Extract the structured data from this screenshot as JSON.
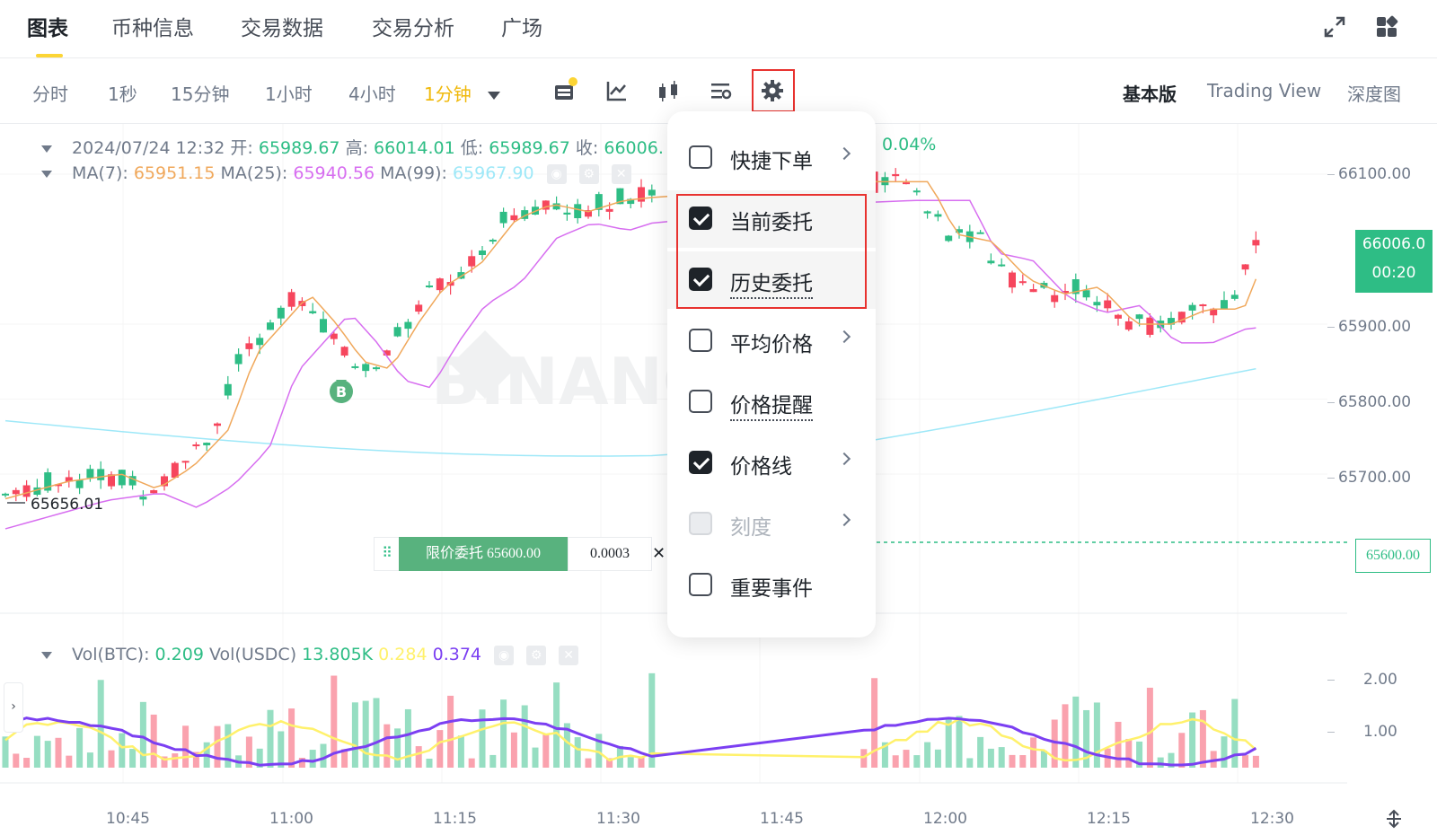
{
  "top_tabs": [
    "图表",
    "币种信息",
    "交易数据",
    "交易分析",
    "广场"
  ],
  "intervals": [
    "分时",
    "1秒",
    "15分钟",
    "1小时",
    "4小时"
  ],
  "active_interval": "1分钟",
  "view_options": [
    "基本版",
    "Trading View",
    "深度图"
  ],
  "legend": {
    "ohlc_prefix": "2024/07/24 12:32",
    "open_label": "开:",
    "open": "65989.67",
    "high_label": "高:",
    "high": "66014.01",
    "low_label": "低:",
    "low": "65989.67",
    "close_label": "收:",
    "close": "66006.",
    "change": "0.04%",
    "ma7_label": "MA(7):",
    "ma7": "65951.15",
    "ma25_label": "MA(25):",
    "ma25": "65940.56",
    "ma99_label": "MA(99):",
    "ma99": "65967.90"
  },
  "vol_legend": {
    "btc_label": "Vol(BTC):",
    "btc": "0.209",
    "usdc_label": "Vol(USDC)",
    "usdc": "13.805K",
    "ma1": "0.284",
    "ma2": "0.374"
  },
  "price_axis": [
    "66100.00",
    "65900.00",
    "65800.00",
    "65700.00"
  ],
  "current_price": "66006.0",
  "countdown": "00:20",
  "order_price_tag": "65600.00",
  "vol_axis": [
    "2.00",
    "1.00"
  ],
  "time_axis": [
    "10:45",
    "11:00",
    "11:15",
    "11:30",
    "11:45",
    "12:00",
    "12:15",
    "12:30"
  ],
  "low_marker": "65656.01",
  "buy_marker": "B",
  "watermark": "BINANCE",
  "order": {
    "label": "限价委托 65600.00",
    "qty": "0.0003"
  },
  "settings_menu": [
    {
      "label": "快捷下单",
      "checked": false,
      "submenu": true
    },
    {
      "label": "当前委托",
      "checked": true,
      "submenu": false
    },
    {
      "label": "历史委托",
      "checked": true,
      "submenu": false
    },
    {
      "label": "平均价格",
      "checked": false,
      "submenu": true
    },
    {
      "label": "价格提醒",
      "checked": false,
      "submenu": false
    },
    {
      "label": "价格线",
      "checked": true,
      "submenu": true
    },
    {
      "label": "刻度",
      "checked": false,
      "submenu": true,
      "disabled": true
    },
    {
      "label": "重要事件",
      "checked": false,
      "submenu": false
    }
  ],
  "colors": {
    "up": "#2ebd85",
    "down": "#f6465d",
    "accent": "#f0b90b",
    "highlight": "#e8322f"
  }
}
